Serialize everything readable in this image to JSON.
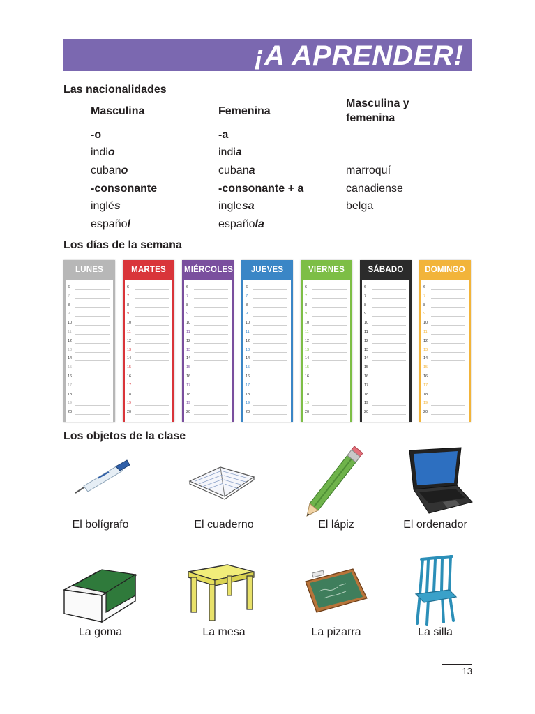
{
  "banner": {
    "title": "¡A APRENDER!",
    "color": "#7b68b0"
  },
  "nationalities": {
    "heading": "Las nacionalidades",
    "columns": [
      "Masculina",
      "Femenina",
      "Masculina y femenina"
    ],
    "rows": [
      {
        "masc": "-o",
        "fem": "-a",
        "both": ""
      },
      {
        "masc_stem": "indi",
        "masc_end": "o",
        "fem_stem": "indi",
        "fem_end": "a",
        "both": ""
      },
      {
        "masc_stem": "cuban",
        "masc_end": "o",
        "fem_stem": "cuban",
        "fem_end": "a",
        "both": "marroquí"
      },
      {
        "masc": "-consonante",
        "fem": "-consonante + a",
        "both": "canadiense"
      },
      {
        "masc_stem": "inglé",
        "masc_end": "s",
        "fem_stem": "ingle",
        "fem_end": "sa",
        "both": "belga"
      },
      {
        "masc_stem": "españo",
        "masc_end": "l",
        "fem_stem": "españo",
        "fem_end": "la",
        "both": ""
      }
    ]
  },
  "week": {
    "heading": "Los días de la semana",
    "days": [
      {
        "label": "LUNES",
        "color": "#b7b7b7"
      },
      {
        "label": "MARTES",
        "color": "#d9353a"
      },
      {
        "label": "MIÉRCOLES",
        "color": "#7a4f9e"
      },
      {
        "label": "JUEVES",
        "color": "#3a86c6"
      },
      {
        "label": "VIERNES",
        "color": "#7dbe46"
      },
      {
        "label": "SÁBADO",
        "color": "#2b2b2b"
      },
      {
        "label": "DOMINGO",
        "color": "#f2b43a"
      }
    ],
    "hours": [
      "6",
      "7",
      "8",
      "9",
      "10",
      "11",
      "12",
      "13",
      "14",
      "15",
      "16",
      "17",
      "18",
      "19",
      "20"
    ]
  },
  "objects": {
    "heading": "Los objetos de la clase",
    "items": [
      {
        "label": "El bolígrafo",
        "icon": "pen-icon"
      },
      {
        "label": "El cuaderno",
        "icon": "notebook-icon"
      },
      {
        "label": "El lápiz",
        "icon": "pencil-icon"
      },
      {
        "label": "El ordenador",
        "icon": "laptop-icon"
      },
      {
        "label": "La goma",
        "icon": "eraser-icon"
      },
      {
        "label": "La mesa",
        "icon": "table-icon"
      },
      {
        "label": "La pizarra",
        "icon": "chalkboard-icon"
      },
      {
        "label": "La silla",
        "icon": "chair-icon"
      }
    ]
  },
  "page": {
    "number": "13"
  }
}
